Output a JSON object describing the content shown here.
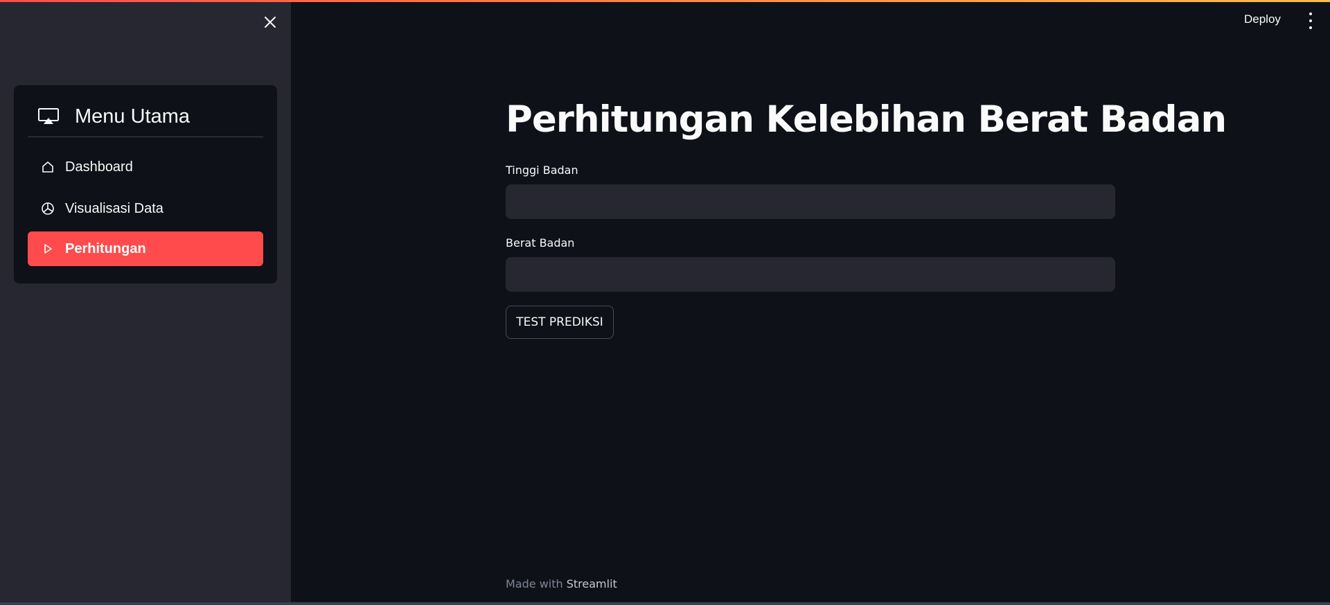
{
  "header": {
    "deploy_label": "Deploy",
    "accent_gradient": [
      "#ff4b4b",
      "#ffbd45"
    ]
  },
  "sidebar": {
    "menu_title": "Menu Utama",
    "items": [
      {
        "label": "Dashboard",
        "icon": "house-icon",
        "active": false
      },
      {
        "label": "Visualisasi Data",
        "icon": "pie-chart-icon",
        "active": false
      },
      {
        "label": "Perhitungan",
        "icon": "play-icon",
        "active": true
      }
    ],
    "active_color": "#ff4b4b"
  },
  "main": {
    "title": "Perhitungan Kelebihan Berat Badan",
    "fields": [
      {
        "label": "Tinggi Badan",
        "value": "",
        "placeholder": ""
      },
      {
        "label": "Berat Badan",
        "value": "",
        "placeholder": ""
      }
    ],
    "button_label": "TEST PREDIKSI"
  },
  "footer": {
    "prefix": "Made with",
    "brand": "Streamlit"
  }
}
